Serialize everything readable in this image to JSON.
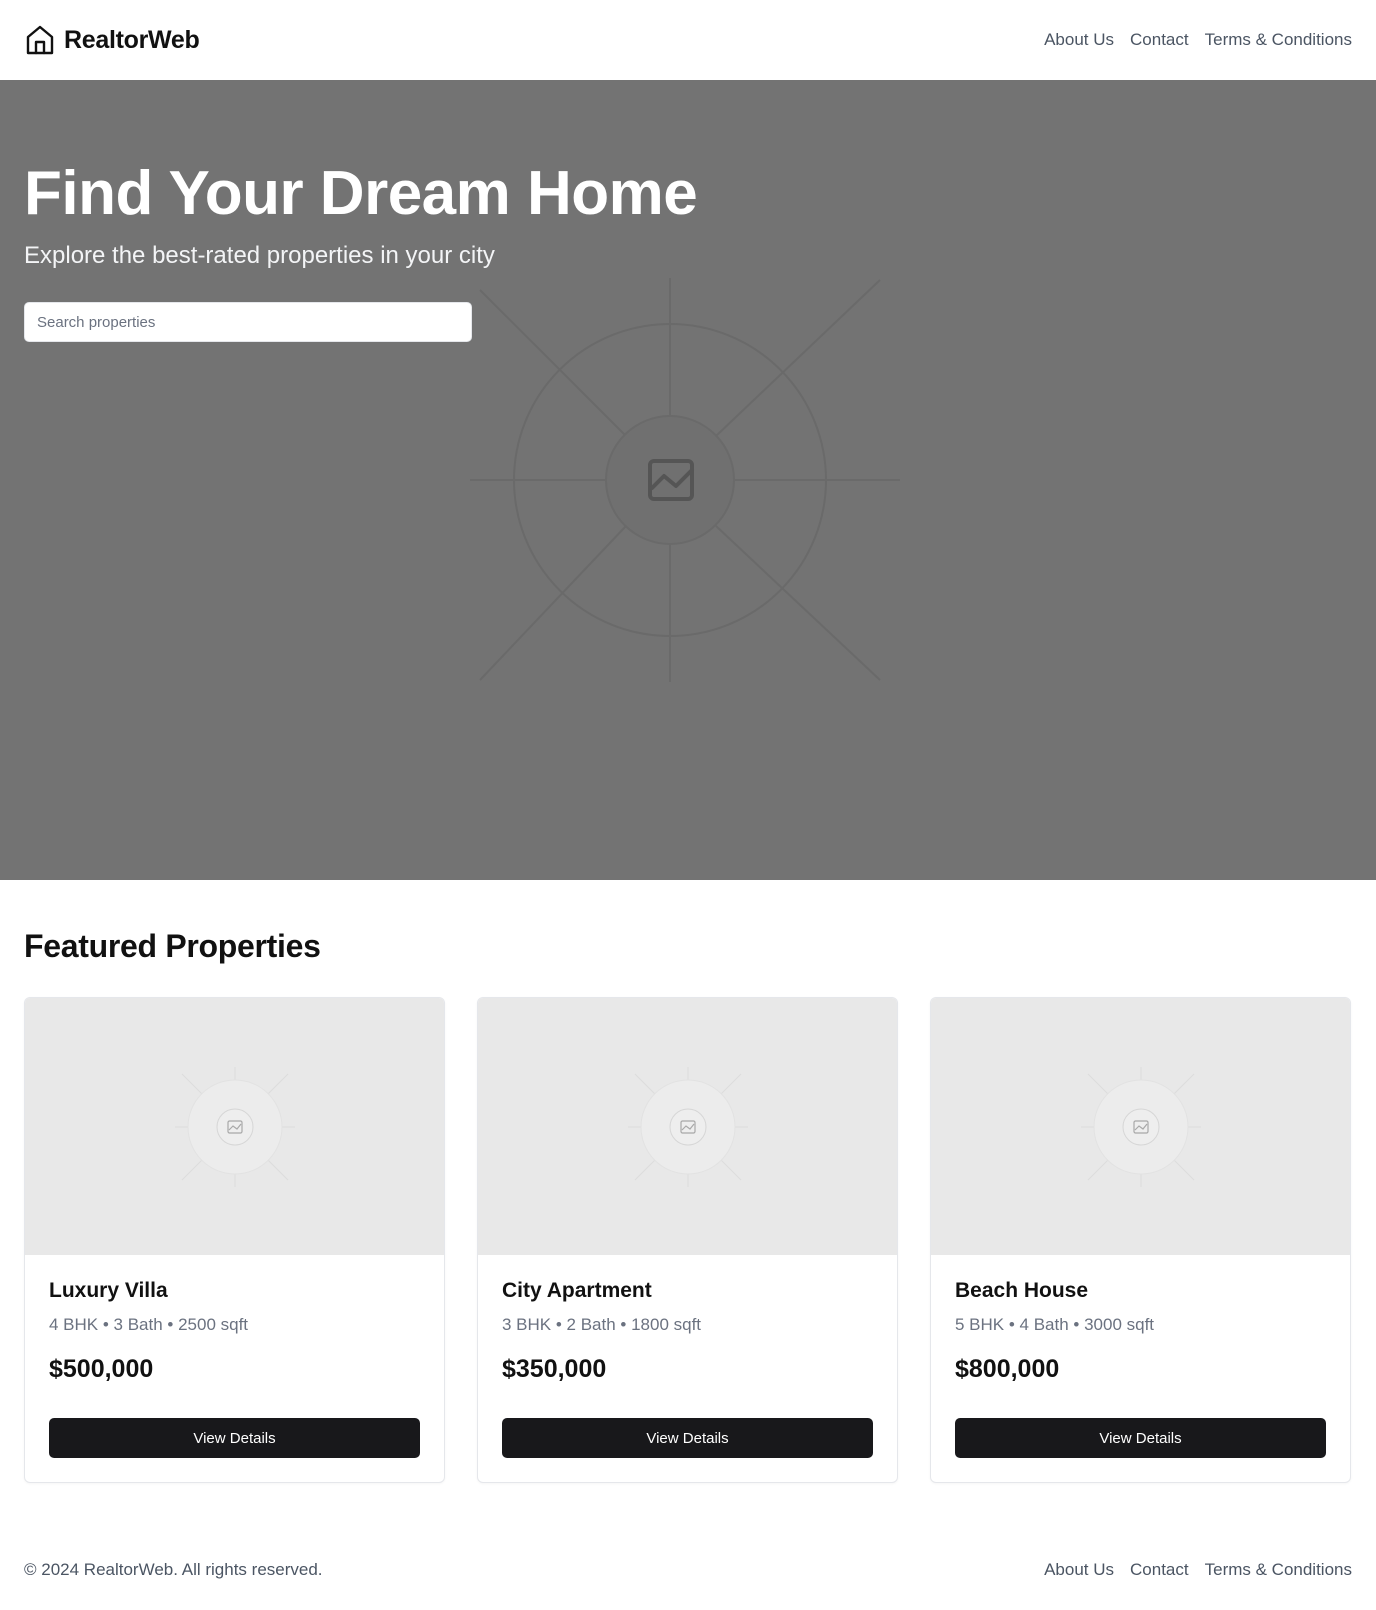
{
  "header": {
    "brand": "RealtorWeb",
    "logo_icon": "home-icon",
    "nav": [
      "About Us",
      "Contact",
      "Terms & Conditions"
    ]
  },
  "hero": {
    "title": "Find Your Dream Home",
    "subtitle": "Explore the best-rated properties in your city",
    "search_placeholder": "Search properties",
    "image_icon": "image-placeholder-icon",
    "background_color": "#737373"
  },
  "featured": {
    "title": "Featured Properties",
    "properties": [
      {
        "name": "Luxury Villa",
        "details": "4 BHK • 3 Bath • 2500 sqft",
        "price": "$500,000",
        "button": "View Details"
      },
      {
        "name": "City Apartment",
        "details": "3 BHK • 2 Bath • 1800 sqft",
        "price": "$350,000",
        "button": "View Details"
      },
      {
        "name": "Beach House",
        "details": "5 BHK • 4 Bath • 3000 sqft",
        "price": "$800,000",
        "button": "View Details"
      }
    ]
  },
  "footer": {
    "copyright": "© 2024 RealtorWeb. All rights reserved.",
    "nav": [
      "About Us",
      "Contact",
      "Terms & Conditions"
    ]
  },
  "colors": {
    "button_bg": "#18181b",
    "text_muted": "#6b7280",
    "image_placeholder_bg": "#e8e8e8"
  }
}
